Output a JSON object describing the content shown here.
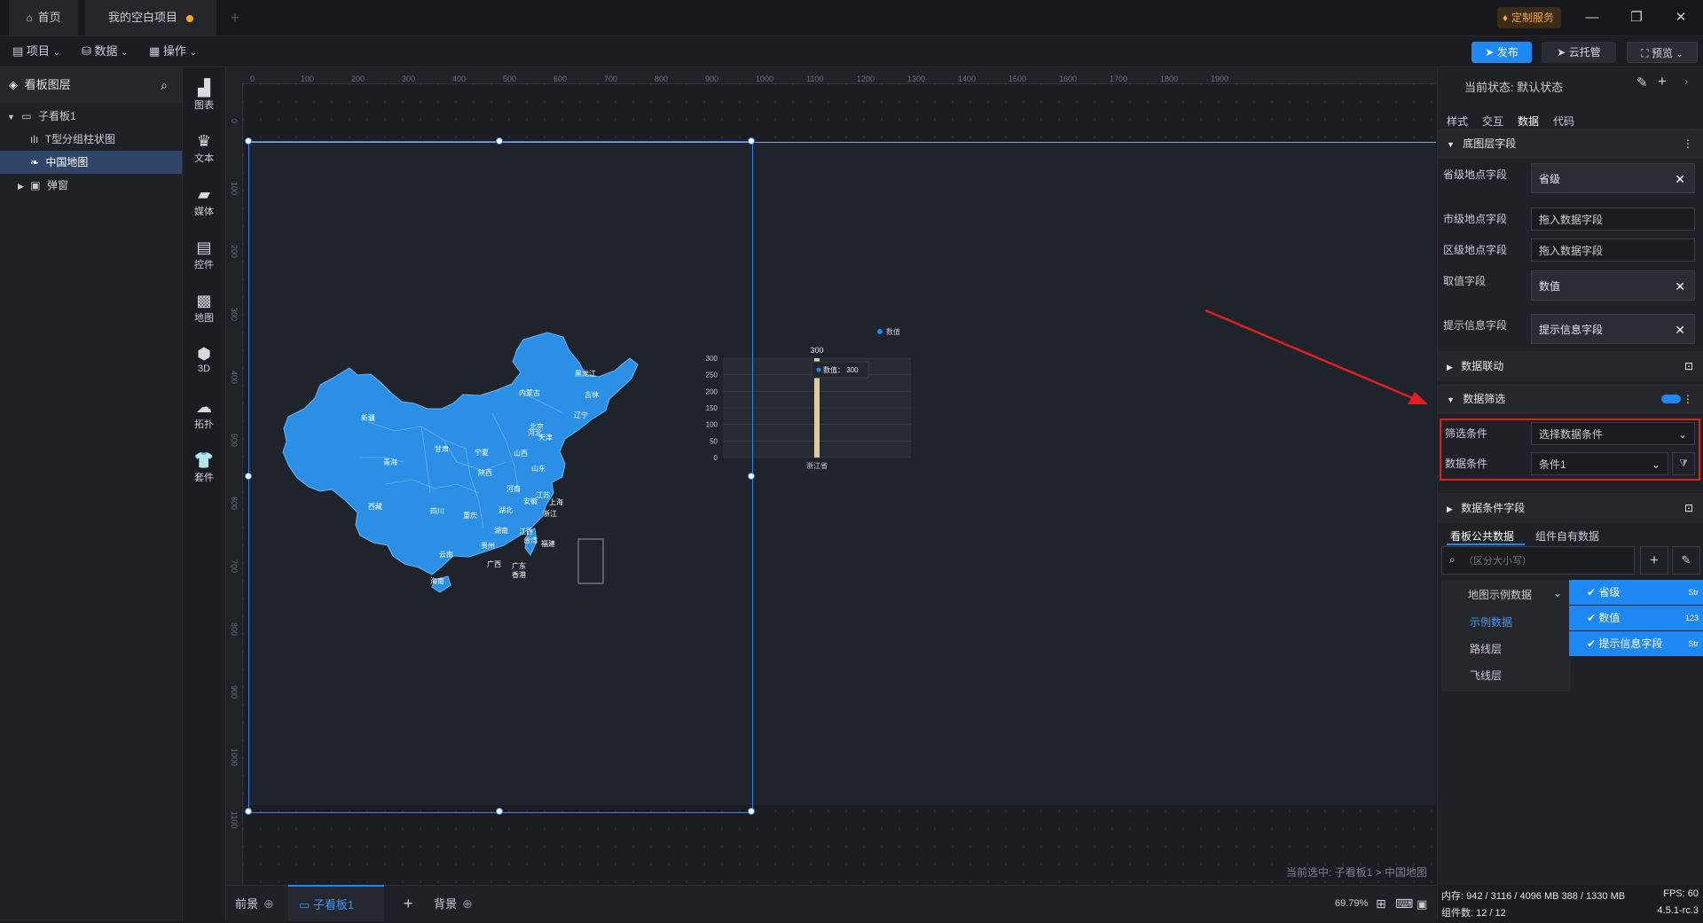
{
  "titlebar": {
    "home_label": "首页",
    "project_tab": "我的空白项目",
    "custom_service": "定制服务",
    "minimize": "—",
    "restore": "❐",
    "close": "✕"
  },
  "menubar": {
    "project": "项目",
    "data": "数据",
    "operation": "操作",
    "publish": "发布",
    "cloud": "云托管",
    "preview": "预览"
  },
  "layers": {
    "title": "看板图层",
    "items": [
      {
        "label": "子看板1"
      },
      {
        "label": "T型分组柱状图"
      },
      {
        "label": "中国地图"
      },
      {
        "label": "弹窗"
      }
    ]
  },
  "tools": [
    {
      "label": "图表",
      "icon": "bar-chart-icon"
    },
    {
      "label": "文本",
      "icon": "crown-text-icon"
    },
    {
      "label": "媒体",
      "icon": "media-icon"
    },
    {
      "label": "控件",
      "icon": "widget-icon"
    },
    {
      "label": "地图",
      "icon": "map-icon"
    },
    {
      "label": "3D",
      "icon": "cube-icon"
    },
    {
      "label": "拓扑",
      "icon": "topology-icon"
    },
    {
      "label": "套件",
      "icon": "kit-icon"
    }
  ],
  "ruler": {
    "top": [
      "0",
      "100",
      "200",
      "300",
      "400",
      "500",
      "600",
      "700",
      "800",
      "900",
      "1000",
      "1100",
      "1200",
      "1300",
      "1400",
      "1500",
      "1600",
      "1700",
      "1800",
      "1900"
    ],
    "left": [
      "0",
      "100",
      "200",
      "300",
      "400",
      "500",
      "600",
      "700",
      "800",
      "900",
      "1000",
      "1100"
    ]
  },
  "map": {
    "provinces": [
      "黑龙江",
      "吉林",
      "辽宁",
      "内蒙古",
      "新疆",
      "甘肃",
      "宁夏",
      "山西",
      "河北",
      "北京",
      "天津",
      "山东",
      "青海",
      "陕西",
      "河南",
      "江苏",
      "上海",
      "安徽",
      "西藏",
      "四川",
      "重庆",
      "湖北",
      "浙江",
      "湖南",
      "江西",
      "贵州",
      "福建",
      "云南",
      "广西",
      "广东",
      "香港",
      "台湾",
      "海南"
    ],
    "color": "#2b8fe6"
  },
  "chart_data": {
    "type": "bar",
    "categories": [
      "浙江省"
    ],
    "series": [
      {
        "name": "数值",
        "values": [
          300
        ]
      }
    ],
    "ylim": [
      0,
      300
    ],
    "yticks": [
      "0",
      "50",
      "100",
      "150",
      "200",
      "250",
      "300"
    ],
    "value_label": "300",
    "legend": "数值",
    "legend_placement": "top-right",
    "tooltip": "数值：  300",
    "bar_color": "#d6cfa6"
  },
  "canvas": {
    "selected_path": "当前选中: 子看板1 > 中国地图"
  },
  "bottombar": {
    "foreground": "前景",
    "board_tab": "子看板1",
    "background": "背景",
    "zoom": "69.79%"
  },
  "props": {
    "state": "当前状态:  默认状态",
    "tabs": [
      "样式",
      "交互",
      "数据",
      "代码"
    ],
    "base_section": "底图层字段",
    "fields": [
      {
        "label": "省级地点字段",
        "value": "省级",
        "filled": true
      },
      {
        "label": "市级地点字段",
        "value": "拖入数据字段",
        "filled": false
      },
      {
        "label": "区级地点字段",
        "value": "拖入数据字段",
        "filled": false
      },
      {
        "label": "取值字段",
        "value": "数值",
        "filled": true
      },
      {
        "label": "提示信息字段",
        "value": "提示信息字段",
        "filled": true
      }
    ],
    "linkage_section": "数据联动",
    "filter_section": "数据筛选",
    "filter_condition_label": "筛选条件",
    "filter_condition_value": "选择数据条件",
    "data_condition_label": "数据条件",
    "data_condition_value": "条件1",
    "condition_fields_section": "数据条件字段",
    "data_tabs": [
      "看板公共数据",
      "组件自有数据"
    ],
    "search_placeholder": "（区分大小写）",
    "datasets": [
      {
        "label": "地图示例数据"
      },
      {
        "label": "示例数据"
      },
      {
        "label": "路线层"
      },
      {
        "label": "飞线层"
      }
    ],
    "columns": [
      {
        "label": "省级",
        "type": "Str"
      },
      {
        "label": "数值",
        "type": "123"
      },
      {
        "label": "提示信息字段",
        "type": "Str"
      }
    ],
    "accent": "#1e88f5",
    "highlight": "#e02020"
  },
  "status": {
    "memory": "内存:  942 / 3116 / 4096 MB  388 / 1330 MB",
    "fps": "FPS:  60",
    "components": "组件数:  12 / 12",
    "version": "4.5.1-rc.3"
  }
}
